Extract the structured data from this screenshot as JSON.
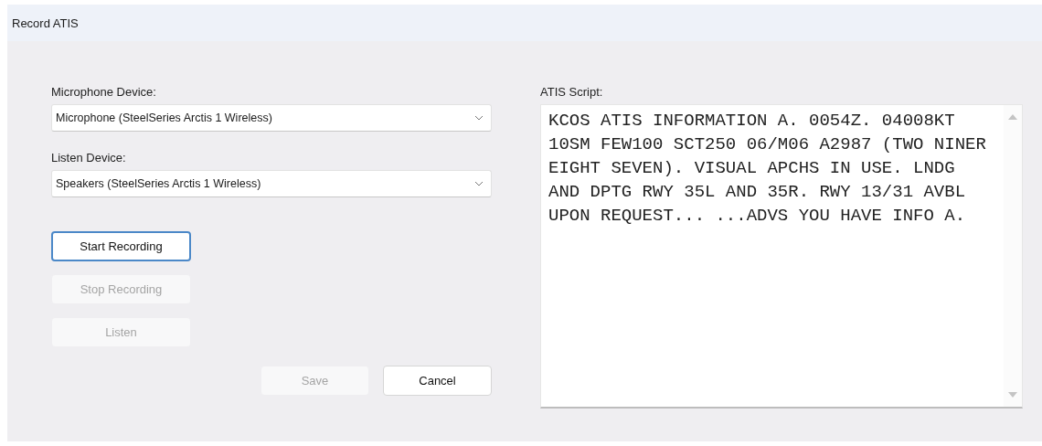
{
  "window": {
    "title": "Record ATIS"
  },
  "devices": [
    {
      "label": "Microphone Device:",
      "value": "Microphone (SteelSeries Arctis 1 Wireless)"
    },
    {
      "label": "Listen Device:",
      "value": "Speakers (SteelSeries Arctis 1 Wireless)"
    }
  ],
  "actions": [
    {
      "label": "Start Recording",
      "disabled": false,
      "focused": true
    },
    {
      "label": "Stop Recording",
      "disabled": true,
      "focused": false
    },
    {
      "label": "Listen",
      "disabled": true,
      "focused": false
    }
  ],
  "footer_buttons": [
    {
      "label": "Save",
      "disabled": true
    },
    {
      "label": "Cancel",
      "disabled": false
    }
  ],
  "script": {
    "label": "ATIS Script:",
    "value": "KCOS ATIS INFORMATION A. 0054Z. 04008KT 10SM FEW100 SCT250 06/M06 A2987 (TWO NINER EIGHT SEVEN). VISUAL APCHS IN USE. LNDG AND DPTG RWY 35L AND 35R. RWY 13/31 AVBL UPON REQUEST... ...ADVS YOU HAVE INFO A."
  }
}
